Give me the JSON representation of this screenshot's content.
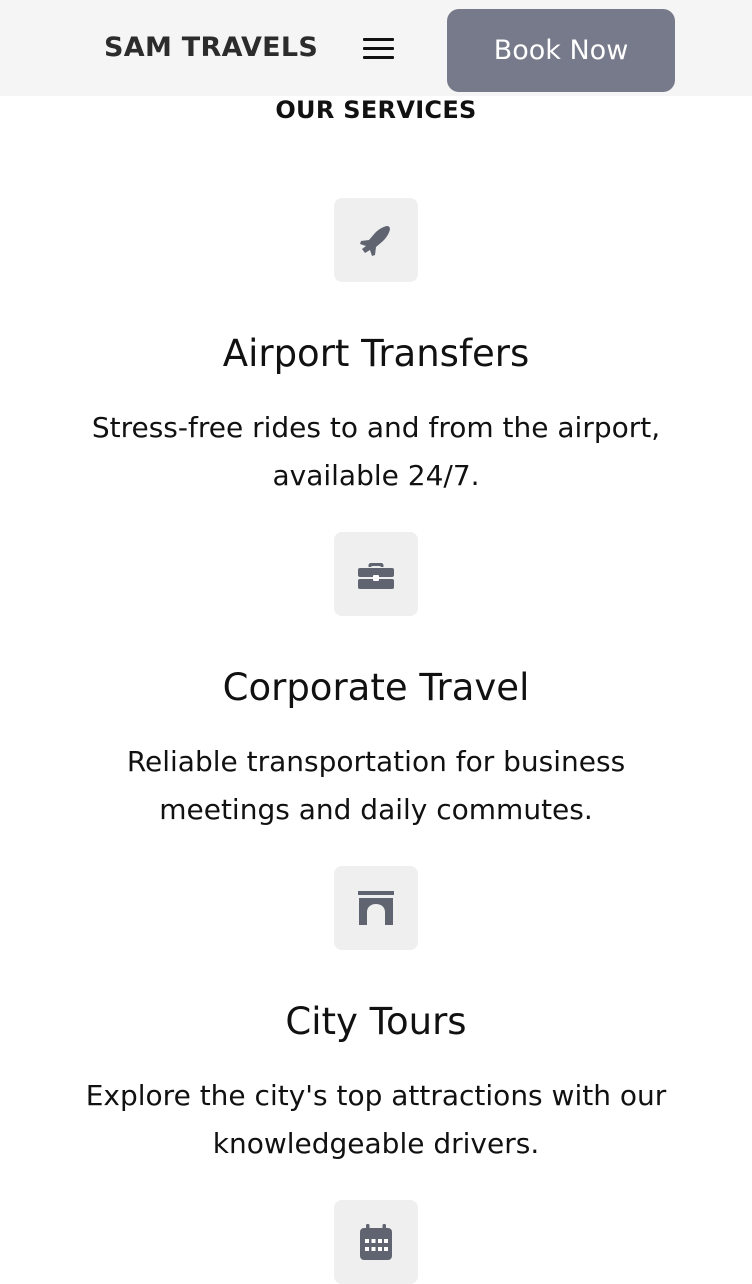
{
  "header": {
    "brand": "SAM TRAVELS",
    "menu_icon": "hamburger-menu-icon",
    "book_label": "Book Now"
  },
  "services_section": {
    "title": "OUR SERVICES",
    "items": [
      {
        "icon": "airplane-icon",
        "title": "Airport Transfers",
        "description": "Stress-free rides to and from the airport, available 24/7."
      },
      {
        "icon": "briefcase-icon",
        "title": "Corporate Travel",
        "description": "Reliable transportation for business meetings and daily commutes."
      },
      {
        "icon": "archway-icon",
        "title": "City Tours",
        "description": "Explore the city's top attractions with our knowledgeable drivers."
      },
      {
        "icon": "calendar-icon"
      }
    ]
  },
  "colors": {
    "header_bg": "#f5f5f5",
    "button_bg": "#767a8a",
    "icon_color": "#5f6470",
    "icon_box_bg": "#efefef"
  }
}
